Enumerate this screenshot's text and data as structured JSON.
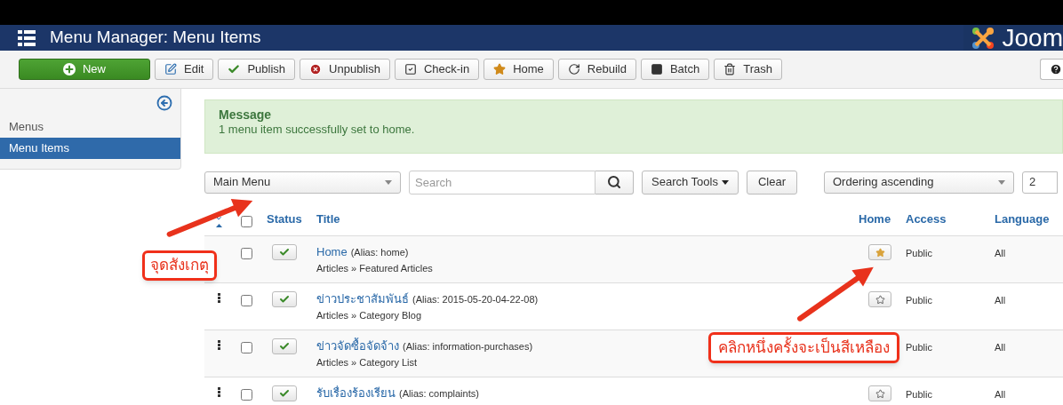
{
  "header": {
    "title": "Menu Manager: Menu Items",
    "logo_text": "Joom"
  },
  "toolbar": [
    {
      "label": "New",
      "kind": "new"
    },
    {
      "label": "Edit",
      "kind": "edit"
    },
    {
      "label": "Publish",
      "kind": "publish"
    },
    {
      "label": "Unpublish",
      "kind": "unpublish"
    },
    {
      "label": "Check-in",
      "kind": "checkin"
    },
    {
      "label": "Home",
      "kind": "home"
    },
    {
      "label": "Rebuild",
      "kind": "rebuild"
    },
    {
      "label": "Batch",
      "kind": "batch"
    },
    {
      "label": "Trash",
      "kind": "trash"
    }
  ],
  "sidebar": {
    "items": [
      {
        "label": "Menus",
        "selected": false
      },
      {
        "label": "Menu Items",
        "selected": true
      }
    ]
  },
  "message": {
    "title": "Message",
    "text": "1 menu item successfully set to home."
  },
  "filters": {
    "menu": "Main Menu",
    "search_placeholder": "Search",
    "search_tools": "Search Tools",
    "clear": "Clear",
    "ordering": "Ordering ascending",
    "limit": "2"
  },
  "table": {
    "columns": {
      "status": "Status",
      "title": "Title",
      "home": "Home",
      "access": "Access",
      "language": "Language"
    },
    "select_all_checked": false,
    "rows": [
      {
        "title": "Home",
        "alias": "(Alias: home)",
        "type": "Articles » Featured Articles",
        "published": true,
        "home": true,
        "access": "Public",
        "language": "All",
        "handle": false,
        "checked": false
      },
      {
        "title": "ข่าวประชาสัมพันธ์",
        "alias": "(Alias: 2015-05-20-04-22-08)",
        "type": "Articles » Category Blog",
        "published": true,
        "home": false,
        "access": "Public",
        "language": "All",
        "handle": true,
        "checked": false
      },
      {
        "title": "ข่าวจัดซื้อจัดจ้าง",
        "alias": "(Alias: information-purchases)",
        "type": "Articles » Category List",
        "published": true,
        "access": "Public",
        "language": "All",
        "handle": true,
        "checked": false
      },
      {
        "title": "รับเรื่องร้องเรียน",
        "alias": "(Alias: complaints)",
        "published": true,
        "home": false,
        "access": "Public",
        "language": "All",
        "handle": true,
        "checked": false
      }
    ]
  },
  "annotations": [
    {
      "text": "จุดสังเกตุ"
    },
    {
      "text": "คลิกหนึ่งครั้งจะเป็นสีเหลือง"
    }
  ]
}
